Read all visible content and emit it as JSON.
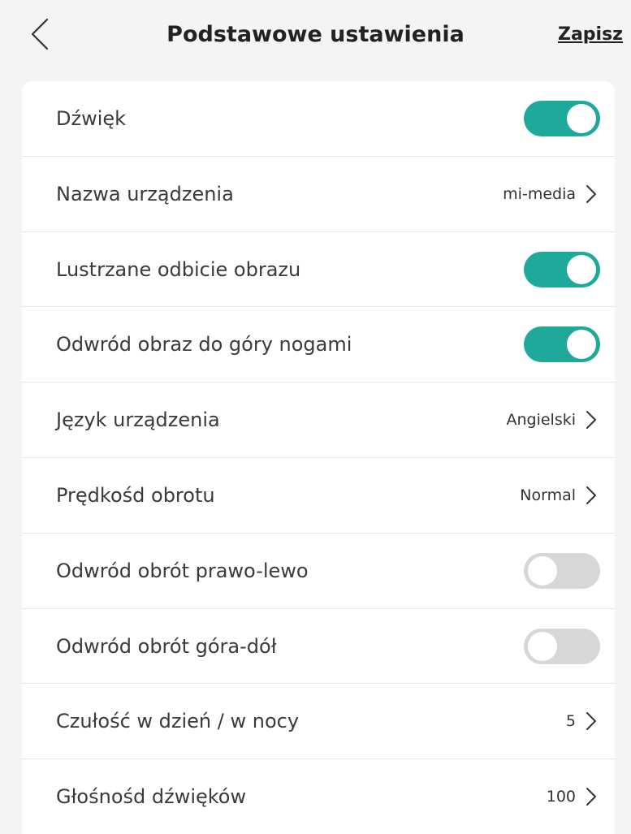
{
  "header": {
    "title": "Podstawowe ustawienia",
    "save_label": "Zapisz",
    "back_icon": "chevron-left-icon"
  },
  "colors": {
    "toggle_on": "#1fa99b",
    "toggle_off": "#d7d7d7",
    "background": "#f4f4f4",
    "card": "#ffffff"
  },
  "settings": [
    {
      "label": "Dźwięk",
      "type": "toggle",
      "checked": true
    },
    {
      "label": "Nazwa urządzenia",
      "type": "link",
      "value": "mi-media"
    },
    {
      "label": "Lustrzane odbicie obrazu",
      "type": "toggle",
      "checked": true
    },
    {
      "label": "Odwród obraz do góry nogami",
      "type": "toggle",
      "checked": true
    },
    {
      "label": "Język urządzenia",
      "type": "link",
      "value": "Angielski"
    },
    {
      "label": "Prędkośd obrotu",
      "type": "link",
      "value": "Normal"
    },
    {
      "label": "Odwród obrót prawo-lewo",
      "type": "toggle",
      "checked": false
    },
    {
      "label": "Odwród obrót góra-dół",
      "type": "toggle",
      "checked": false
    },
    {
      "label": "Czułość w dzień / w nocy",
      "type": "link",
      "value": "5"
    },
    {
      "label": "Głośnośd dźwięków",
      "type": "link",
      "value": "100"
    }
  ]
}
